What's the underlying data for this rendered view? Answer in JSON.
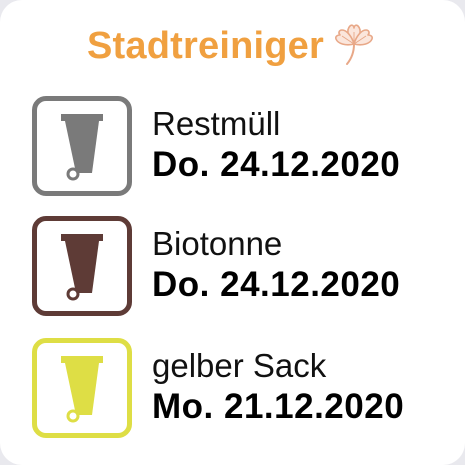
{
  "header": {
    "title": "Stadtreiniger",
    "logo_icon": "cloverleaf-logo-icon",
    "title_color": "#f0a040"
  },
  "items": [
    {
      "type": "Restmüll",
      "date": "Do. 24.12.2020",
      "icon": "trash-bin-icon",
      "color": "#7a7a7a"
    },
    {
      "type": "Biotonne",
      "date": "Do. 24.12.2020",
      "icon": "trash-bin-icon",
      "color": "#5e3b36"
    },
    {
      "type": "gelber Sack",
      "date": "Mo. 21.12.2020",
      "icon": "trash-bin-icon",
      "color": "#dede45"
    }
  ]
}
